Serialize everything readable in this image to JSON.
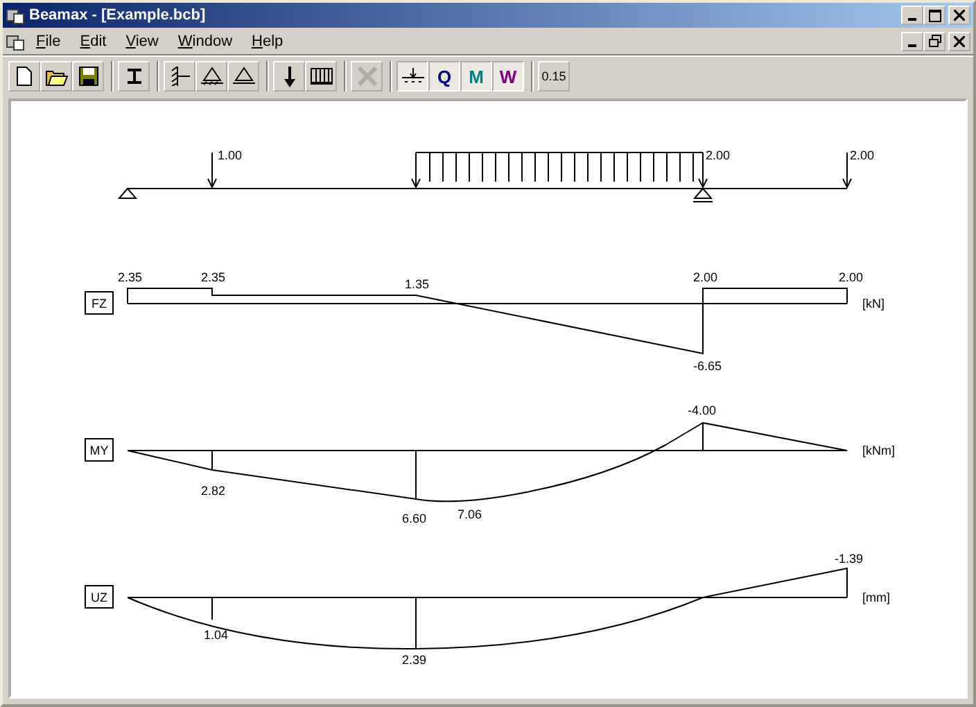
{
  "window": {
    "title": "Beamax - [Example.bcb]"
  },
  "menu": [
    {
      "label": "File"
    },
    {
      "label": "Edit"
    },
    {
      "label": "View"
    },
    {
      "label": "Window"
    },
    {
      "label": "Help"
    }
  ],
  "toolbar": [
    [
      {
        "kind": "new",
        "pressed": false,
        "disabled": false
      },
      {
        "kind": "open",
        "pressed": false,
        "disabled": false
      },
      {
        "kind": "save",
        "pressed": false,
        "disabled": false
      }
    ],
    [
      {
        "kind": "section",
        "pressed": false,
        "disabled": false
      }
    ],
    [
      {
        "kind": "fixed",
        "pressed": false,
        "disabled": false
      },
      {
        "kind": "pin",
        "pressed": false,
        "disabled": false
      },
      {
        "kind": "roller",
        "pressed": false,
        "disabled": false
      }
    ],
    [
      {
        "kind": "point-load",
        "pressed": false,
        "disabled": false
      },
      {
        "kind": "line-load",
        "pressed": false,
        "disabled": false
      }
    ],
    [
      {
        "kind": "delete",
        "pressed": false,
        "disabled": true
      }
    ],
    [
      {
        "kind": "axis",
        "pressed": true,
        "disabled": false
      },
      {
        "kind": "text",
        "label": "Q",
        "pressed": true,
        "disabled": false
      },
      {
        "kind": "text",
        "label": "M",
        "pressed": true,
        "disabled": false
      },
      {
        "kind": "text",
        "label": "W",
        "pressed": true,
        "disabled": false
      }
    ],
    [
      {
        "kind": "text",
        "label": "0.15",
        "pressed": false,
        "disabled": false
      }
    ]
  ],
  "load_labels": [
    "1.00",
    "2.00",
    "2.00"
  ],
  "diagrams": [
    {
      "kind": "shear",
      "label": "FZ",
      "unit": "[kN]",
      "values": [
        "2.35",
        "2.35",
        "1.35",
        "2.00",
        "2.00",
        "-6.65"
      ]
    },
    {
      "kind": "moment",
      "label": "MY",
      "unit": "[kNm]",
      "values": [
        "-4.00",
        "2.82",
        "6.60",
        "7.06"
      ]
    },
    {
      "kind": "deflection",
      "label": "UZ",
      "unit": "[mm]",
      "values": [
        "-1.39",
        "1.04",
        "2.39"
      ]
    }
  ]
}
